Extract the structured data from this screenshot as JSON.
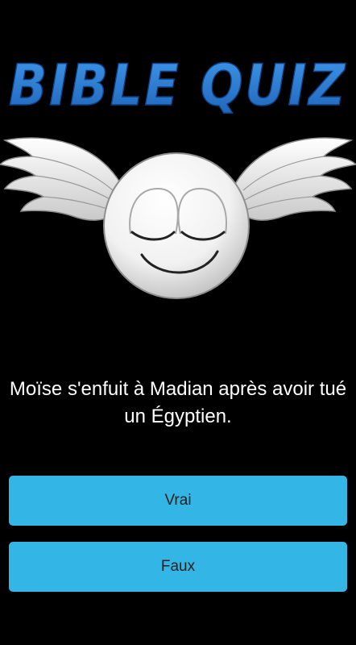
{
  "app": {
    "logo_text": "BIBLE QUIZ"
  },
  "mascot": {
    "icon": "winged-smiley-icon"
  },
  "quiz": {
    "question": "Moïse s'enfuit à Madian après avoir tué un Égyptien.",
    "answers": {
      "true_label": "Vrai",
      "false_label": "Faux"
    }
  },
  "colors": {
    "background": "#000000",
    "logo_blue": "#2b7fd6",
    "button": "#33b5e5",
    "question_text": "#ffffff",
    "button_text": "#222222"
  }
}
